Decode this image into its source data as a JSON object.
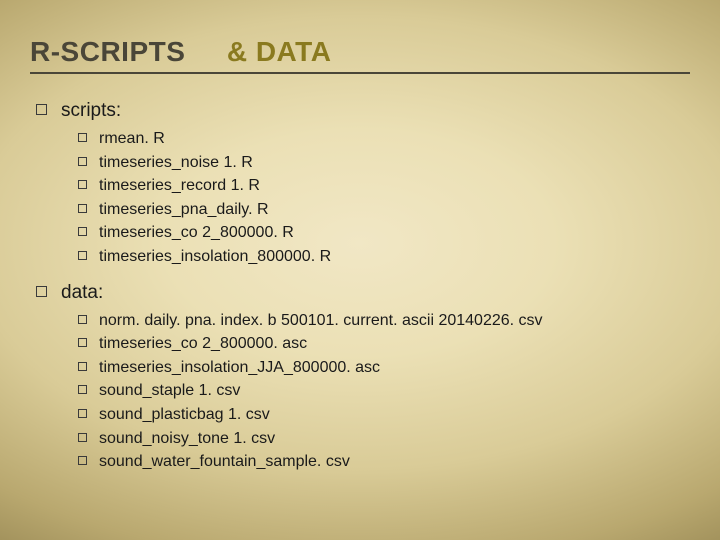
{
  "title": {
    "part1": "R-SCRIPTS",
    "part2": "& DATA"
  },
  "sections": [
    {
      "label": "scripts:",
      "items": [
        "rmean. R",
        "timeseries_noise 1. R",
        "timeseries_record 1. R",
        "timeseries_pna_daily. R",
        "timeseries_co 2_800000. R",
        "timeseries_insolation_800000. R"
      ]
    },
    {
      "label": "data:",
      "items": [
        "norm. daily. pna. index. b 500101. current. ascii 20140226. csv",
        "timeseries_co 2_800000. asc",
        "timeseries_insolation_JJA_800000. asc",
        "sound_staple 1. csv",
        "sound_plasticbag 1. csv",
        "sound_noisy_tone 1. csv",
        "sound_water_fountain_sample. csv"
      ]
    }
  ]
}
